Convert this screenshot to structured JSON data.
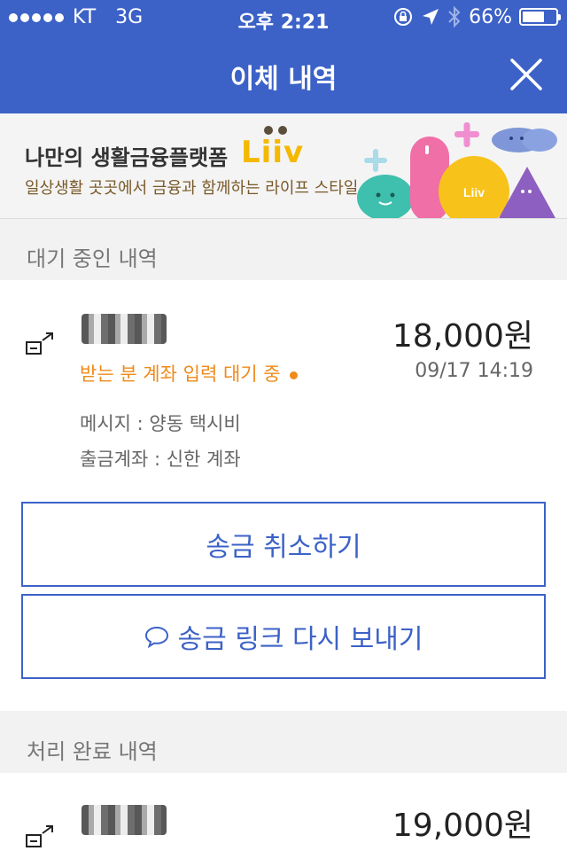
{
  "status_bar": {
    "carrier": "KT",
    "network": "3G",
    "time": "오후 2:21",
    "battery": "66%",
    "battery_level": 0.66
  },
  "header": {
    "title": "이체 내역"
  },
  "banner": {
    "title": "나만의 생활금융플랫폼",
    "brand": "Liiv",
    "subtitle": "일상생활 곳곳에서 금융과 함께하는 라이프 스타일"
  },
  "pending_section": {
    "label": "대기 중인 내역",
    "item": {
      "amount": "18,000원",
      "status": "받는 분 계좌 입력 대기 중",
      "datetime": "09/17 14:19",
      "message": "메시지 : 양동 택시비",
      "account": "출금계좌 : 신한 계좌"
    },
    "cancel_button": "송금 취소하기",
    "resend_button": "송금 링크 다시 보내기"
  },
  "done_section": {
    "label": "처리 완료 내역",
    "item": {
      "amount": "19,000원"
    }
  },
  "colors": {
    "brand_blue": "#3c62c7",
    "status_orange": "#ef8a1a",
    "liiv_yellow": "#f5b800"
  }
}
